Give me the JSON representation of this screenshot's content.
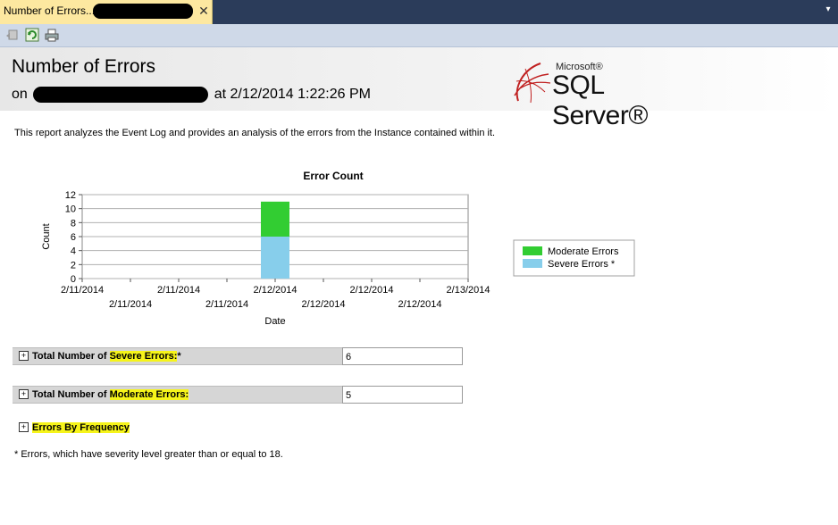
{
  "tab": {
    "title": "Number of Errors...",
    "close_glyph": "✕",
    "dropdown_glyph": "▾"
  },
  "toolbar": {
    "buttons": [
      "back-icon",
      "refresh-icon",
      "print-icon"
    ]
  },
  "header": {
    "title": "Number of Errors",
    "subtitle_prefix": "on",
    "subtitle_suffix": "at 2/12/2014 1:22:26 PM",
    "logo_microsoft": "Microsoft®",
    "logo_product": "SQL Server®"
  },
  "description": "This report analyzes the Event Log and provides an analysis of the errors from the Instance contained within it.",
  "chart_data": {
    "type": "bar",
    "title": "Error Count",
    "xlabel": "Date",
    "ylabel": "Count",
    "ylim": [
      0,
      12
    ],
    "yticks": [
      0,
      2,
      4,
      6,
      8,
      10,
      12
    ],
    "xtick_labels": [
      "2/11/2014",
      "2/11/2014",
      "2/11/2014",
      "2/11/2014",
      "2/12/2014",
      "2/12/2014",
      "2/12/2014",
      "2/12/2014",
      "2/13/2014"
    ],
    "stacked": true,
    "bar_category": "2/12/2014",
    "series": [
      {
        "name": "Severe Errors *",
        "value": 6,
        "color": "#87ceeb"
      },
      {
        "name": "Moderate Errors",
        "value": 5,
        "color": "#32cd32"
      }
    ],
    "legend_position": "right",
    "grid": true
  },
  "summary": {
    "severe_label_pre": "Total Number of ",
    "severe_label_hl": "Severe Errors:",
    "severe_label_post": "*",
    "severe_value": "6",
    "moderate_label_pre": "Total Number of ",
    "moderate_label_hl": "Moderate Errors:",
    "moderate_value": "5",
    "frequency_label": "Errors By Frequency",
    "expand_glyph": "+"
  },
  "footnote": "* Errors, which have severity level greater than or equal to 18.",
  "colors": {
    "highlight": "#f6f41a",
    "tab": "#fde8a0",
    "toolbar": "#cfd9e8"
  }
}
